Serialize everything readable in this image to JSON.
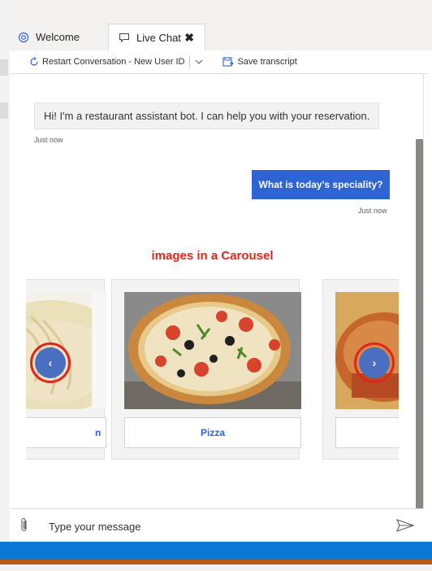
{
  "tabs": [
    {
      "label": "Welcome",
      "icon": "globe-icon"
    },
    {
      "label": "Live Chat",
      "icon": "chat-icon",
      "close": "✖"
    }
  ],
  "toolbar": {
    "restart_label": "Restart Conversation - New User ID",
    "save_label": "Save transcript"
  },
  "messages": {
    "bot_text": "Hi! I'm a restaurant assistant bot. I can help you with your reservation.",
    "bot_time": "Just now",
    "user_text": "What is today's speciality?",
    "user_time": "Just now"
  },
  "annotation": "images in a Carousel",
  "carousel": {
    "cards": [
      {
        "label": "n"
      },
      {
        "label": "Pizza"
      },
      {
        "label": ""
      }
    ],
    "prev_glyph": "‹",
    "next_glyph": "›"
  },
  "composer": {
    "placeholder": "Type your message"
  },
  "colors": {
    "accent": "#2e63d4",
    "annotation": "#e1261c",
    "taskbar": "#0a78d4"
  }
}
